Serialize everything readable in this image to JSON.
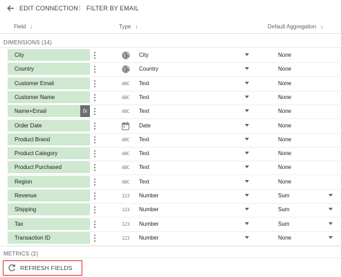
{
  "header": {
    "back_icon": "arrow-left-icon",
    "edit_label": "EDIT CONNECTION",
    "separator": "|",
    "filter_label": "FILTER BY EMAIL"
  },
  "columns": {
    "field": "Field",
    "type": "Type",
    "aggregation": "Default Aggregation",
    "sort_icon": "arrow-down-icon"
  },
  "dimensions_label": "DIMENSIONS (14)",
  "metrics_label": "METRICS (2)",
  "fields": [
    {
      "name": "City",
      "type_icon": "globe-icon",
      "type": "City",
      "aggregation": "None",
      "agg_dropdown": false,
      "formula": false
    },
    {
      "name": "Country",
      "type_icon": "globe-icon",
      "type": "Country",
      "aggregation": "None",
      "agg_dropdown": false,
      "formula": false
    },
    {
      "name": "Customer Email",
      "type_icon": "abc-icon",
      "type": "Text",
      "aggregation": "None",
      "agg_dropdown": false,
      "formula": false
    },
    {
      "name": "Customer Name",
      "type_icon": "abc-icon",
      "type": "Text",
      "aggregation": "None",
      "agg_dropdown": false,
      "formula": false
    },
    {
      "name": "Name+Email",
      "type_icon": "abc-icon",
      "type": "Text",
      "aggregation": "None",
      "agg_dropdown": false,
      "formula": true,
      "formula_label": "fx"
    },
    {
      "name": "Order Date",
      "type_icon": "calendar-icon",
      "type": "Date",
      "aggregation": "None",
      "agg_dropdown": false,
      "formula": false
    },
    {
      "name": "Product Brand",
      "type_icon": "abc-icon",
      "type": "Text",
      "aggregation": "None",
      "agg_dropdown": false,
      "formula": false
    },
    {
      "name": "Product Category",
      "type_icon": "abc-icon",
      "type": "Text",
      "aggregation": "None",
      "agg_dropdown": false,
      "formula": false
    },
    {
      "name": "Product Purchased",
      "type_icon": "abc-icon",
      "type": "Text",
      "aggregation": "None",
      "agg_dropdown": false,
      "formula": false
    },
    {
      "name": "Region",
      "type_icon": "abc-icon",
      "type": "Text",
      "aggregation": "None",
      "agg_dropdown": false,
      "formula": false
    },
    {
      "name": "Revenue",
      "type_icon": "number-icon",
      "type": "Number",
      "aggregation": "Sum",
      "agg_dropdown": true,
      "formula": false
    },
    {
      "name": "Shipping",
      "type_icon": "number-icon",
      "type": "Number",
      "aggregation": "Sum",
      "agg_dropdown": true,
      "formula": false
    },
    {
      "name": "Tax",
      "type_icon": "number-icon",
      "type": "Number",
      "aggregation": "Sum",
      "agg_dropdown": true,
      "formula": false
    },
    {
      "name": "Transaction ID",
      "type_icon": "number-icon",
      "type": "Number",
      "aggregation": "None",
      "agg_dropdown": true,
      "formula": false
    }
  ],
  "icon_text": {
    "abc": "ABC",
    "number": "123"
  },
  "refresh_button": {
    "label": "REFRESH FIELDS",
    "icon": "refresh-icon"
  },
  "colors": {
    "pill": "#cfe8d0",
    "fx_badge": "#6d6f6e",
    "highlight_border": "#e02424"
  }
}
